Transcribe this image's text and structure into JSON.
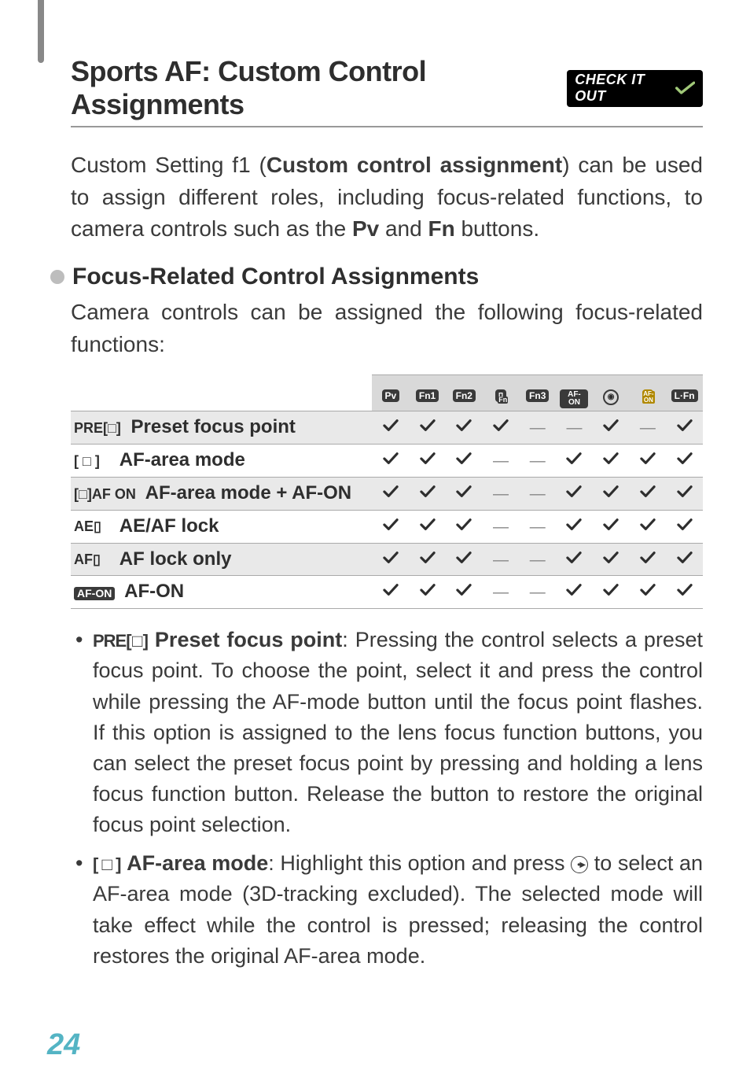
{
  "header": {
    "title": "Sports AF: Custom Control Assignments",
    "badge": "CHECK IT OUT"
  },
  "intro": {
    "text_pre": "Custom Setting f1 (",
    "bold1": "Custom control assignment",
    "text_mid": ") can be used to assign different roles, including focus-related functions, to camera controls such as the ",
    "bold2": "Pv",
    "text_mid2": " and ",
    "bold3": "Fn",
    "text_end": " buttons."
  },
  "section": {
    "heading": "Focus-Related Control Assignments",
    "para": "Camera controls can be assigned the following focus-related functions:"
  },
  "chart_data": {
    "type": "table",
    "title": "Focus-Related Control Assignments compatibility matrix",
    "columns": [
      "Pv",
      "Fn1",
      "Fn2",
      "Vert-Fn",
      "Fn3",
      "AF-ON",
      "Multi-selector-center",
      "Vert-AF-ON",
      "L-Fn"
    ],
    "rows": [
      {
        "icon": "PRE[·]",
        "label": "Preset focus point",
        "values": [
          true,
          true,
          true,
          true,
          false,
          false,
          true,
          false,
          true
        ]
      },
      {
        "icon": "[·]",
        "label": "AF-area mode",
        "values": [
          true,
          true,
          true,
          false,
          false,
          true,
          true,
          true,
          true
        ]
      },
      {
        "icon": "[·]AF-ON",
        "label": "AF-area mode + AF-ON",
        "values": [
          true,
          true,
          true,
          false,
          false,
          true,
          true,
          true,
          true
        ]
      },
      {
        "icon": "AE/AF",
        "label": "AE/AF lock",
        "values": [
          true,
          true,
          true,
          false,
          false,
          true,
          true,
          true,
          true
        ]
      },
      {
        "icon": "AF-L",
        "label": "AF lock only",
        "values": [
          true,
          true,
          true,
          false,
          false,
          true,
          true,
          true,
          true
        ]
      },
      {
        "icon": "AF-ON",
        "label": "AF-ON",
        "values": [
          true,
          true,
          true,
          false,
          false,
          true,
          true,
          true,
          true
        ]
      }
    ]
  },
  "table_headers_display": {
    "c0": "Pv",
    "c1": "Fn1",
    "c2": "Fn2",
    "c3": "Fn",
    "c4": "Fn3",
    "c5": "AF-ON",
    "c7": "AF-ON",
    "c8": "L·Fn"
  },
  "table_rows_display": {
    "r0_icon": "PRE[□]",
    "r0_label": "Preset focus point",
    "r1_icon": "[ □ ]",
    "r1_label": "AF-area mode",
    "r2_icon": "[□]AF ON",
    "r2_label": "AF-area mode + AF-ON",
    "r3_icon": "AE▯",
    "r3_label": "AE/AF lock",
    "r4_icon": "AF▯",
    "r4_label": "AF lock only",
    "r5_icon": "AF-ON",
    "r5_label": "AF-ON"
  },
  "bullets": {
    "b0_icon": "PRE[□]",
    "b0_label": "Preset focus point",
    "b0_text": ": Pressing the control selects a preset focus point. To choose the point, select it and press the control while pressing the AF-mode button until the focus point flashes. If this option is assigned to the lens focus function buttons, you can select the preset focus point by pressing and holding a lens focus function button. Release the button to restore the original focus point selection.",
    "b1_icon": "[ □ ]",
    "b1_label": "AF-area mode",
    "b1_text_pre": ": Highlight this option and press ",
    "b1_text_post": " to select an AF-area mode (3D-tracking excluded). The selected mode will take effect while the control is pressed; releasing the control restores the original AF-area mode."
  },
  "page_number": "24"
}
